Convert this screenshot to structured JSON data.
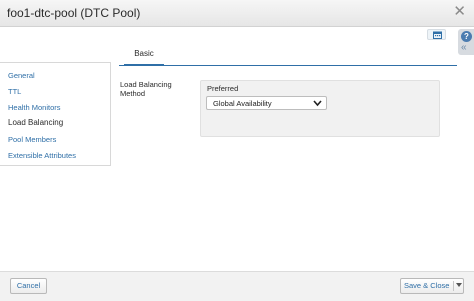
{
  "window": {
    "title": "foo1-dtc-pool (DTC Pool)"
  },
  "toolbar": {
    "calendar_icon": "calendar-icon",
    "help_icon": "help-icon",
    "collapse_icon": "double-chevron-left-icon"
  },
  "tabs": [
    {
      "label": "Basic",
      "active": true
    }
  ],
  "sidebar": {
    "items": [
      {
        "label": "General",
        "active": false
      },
      {
        "label": "TTL",
        "active": false
      },
      {
        "label": "Health Monitors",
        "active": false
      },
      {
        "label": "Load Balancing",
        "active": true
      },
      {
        "label": "Pool Members",
        "active": false
      },
      {
        "label": "Extensible Attributes",
        "active": false
      }
    ]
  },
  "form": {
    "lb_method_label": "Load Balancing Method",
    "preferred_label": "Preferred",
    "preferred_value": "Global Availability"
  },
  "footer": {
    "cancel_label": "Cancel",
    "save_label": "Save & Close"
  },
  "colors": {
    "link": "#2f6fa7",
    "accent": "#2f6fa7",
    "panel": "#f1f1f1"
  }
}
